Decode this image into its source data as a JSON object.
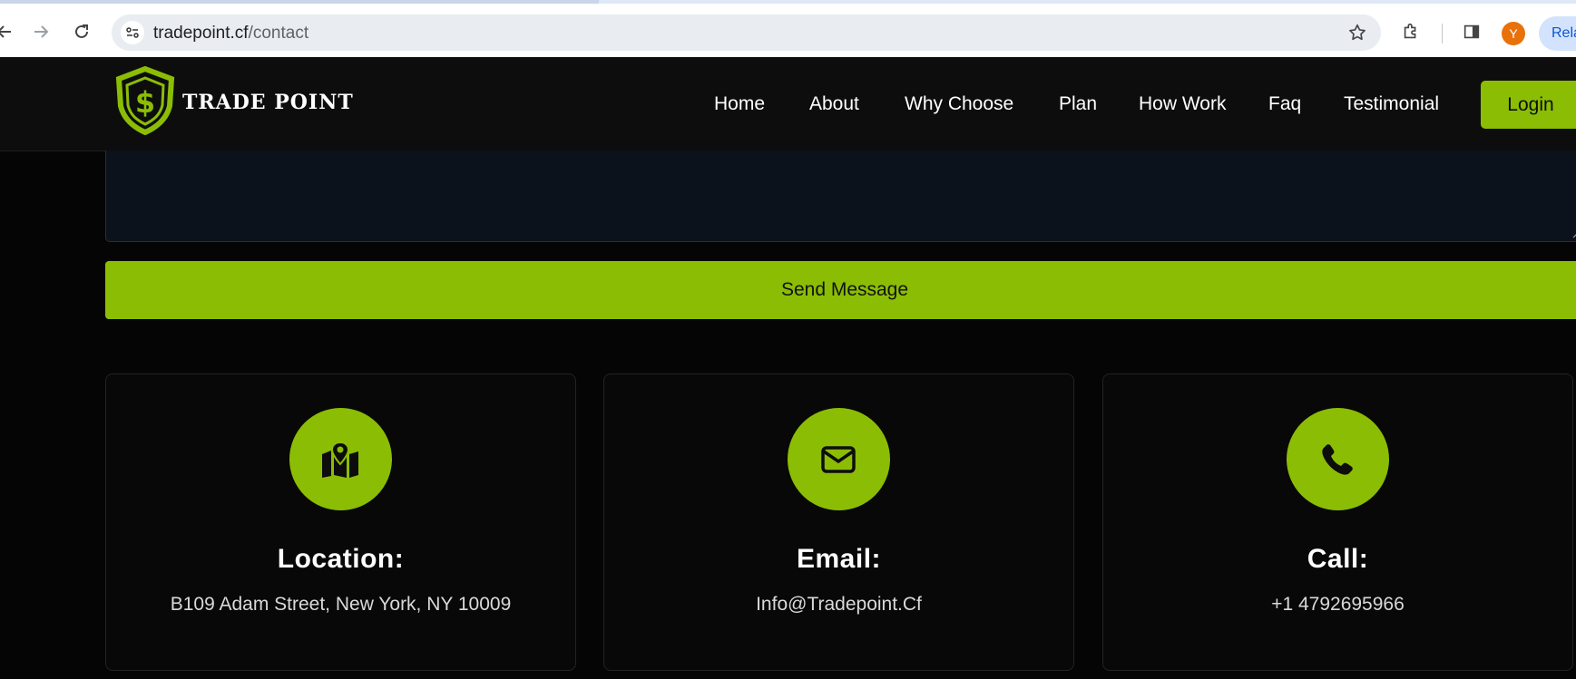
{
  "browser": {
    "url_domain": "tradepoint.cf",
    "url_path": "/contact",
    "avatar_letter": "Y",
    "relaunch_label": "Rela",
    "icons": [
      "back-arrow-icon",
      "forward-arrow-icon",
      "reload-icon",
      "site-info-icon",
      "bookmark-star-icon",
      "extensions-icon",
      "side-panel-icon"
    ]
  },
  "site": {
    "logo_text": "TRADE POINT",
    "logo_icon": "shield-dollar-icon",
    "nav": [
      "Home",
      "About",
      "Why Choose",
      "Plan",
      "How Work",
      "Faq",
      "Testimonial"
    ],
    "login_label": "Login",
    "brand_color": "#8bbd04"
  },
  "form": {
    "message_value": "",
    "send_label": "Send Message"
  },
  "contact_cards": [
    {
      "icon": "map-location-icon",
      "title": "Location:",
      "text": "B109 Adam Street, New York, NY 10009"
    },
    {
      "icon": "envelope-icon",
      "title": "Email:",
      "text": "Info@Tradepoint.Cf"
    },
    {
      "icon": "phone-icon",
      "title": "Call:",
      "text": "+1 4792695966"
    }
  ]
}
